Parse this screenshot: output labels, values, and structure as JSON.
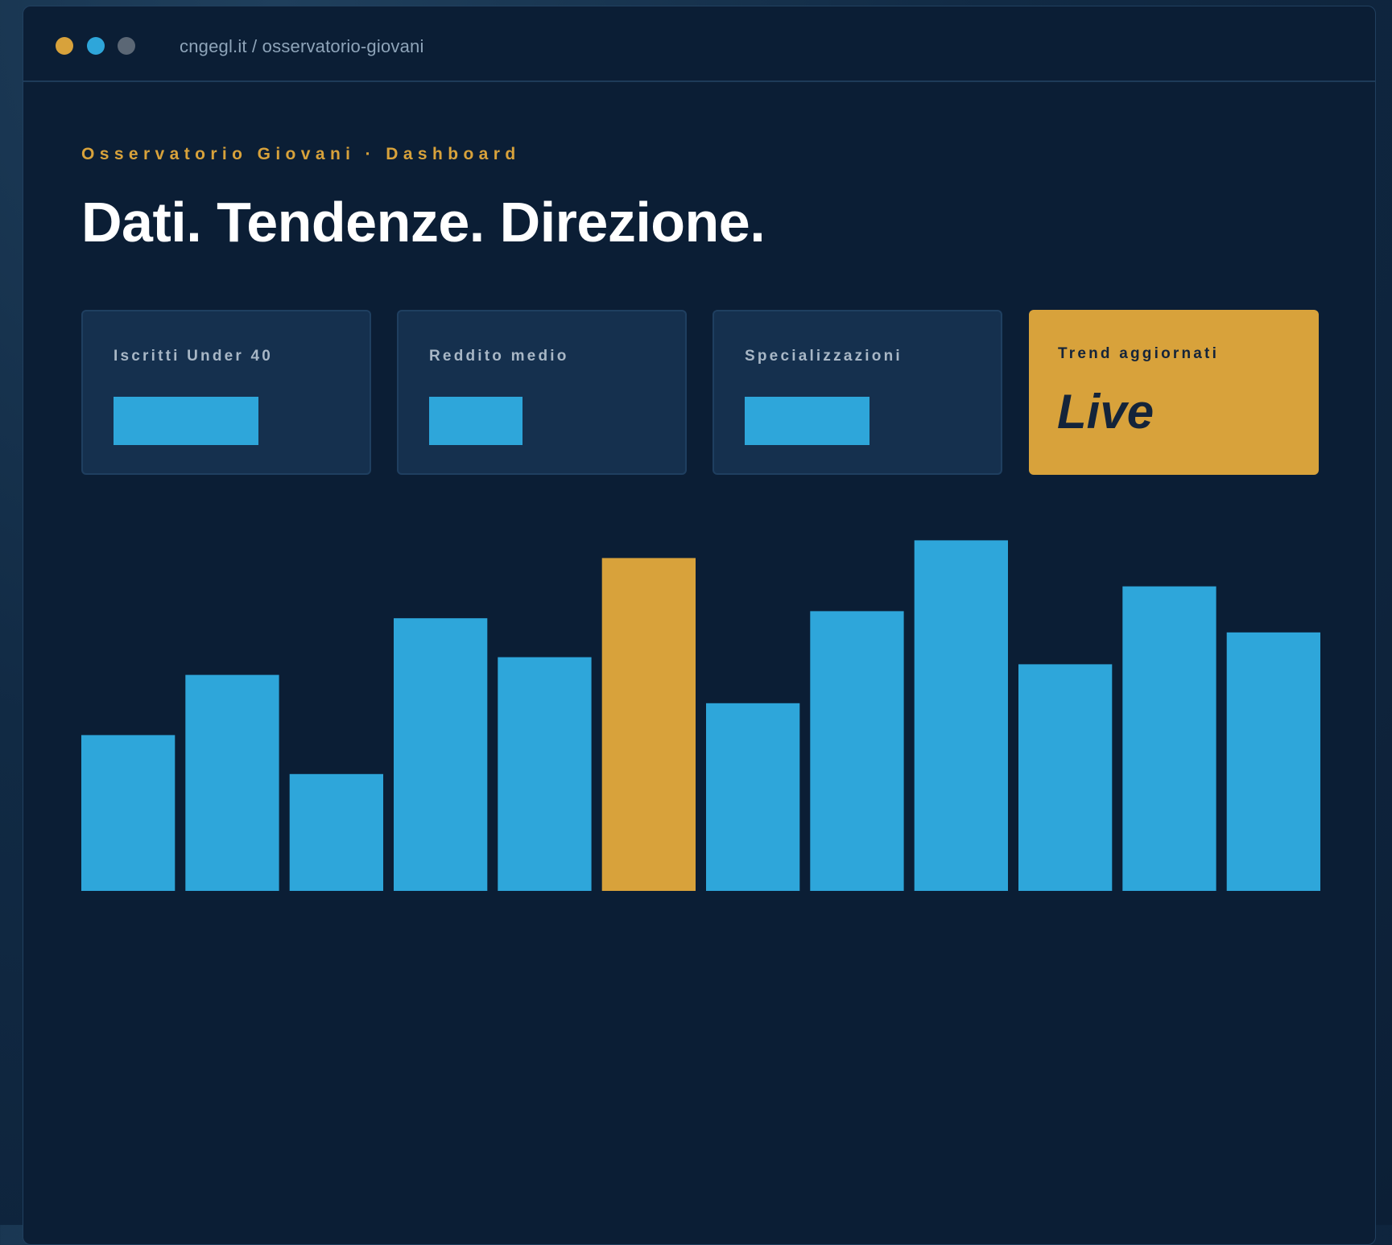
{
  "window": {
    "url": "cngegl.it / osservatorio-giovani",
    "traffic_lights": [
      {
        "name": "dot-amber",
        "color": "#d8a23b"
      },
      {
        "name": "dot-blue",
        "color": "#2ea6da"
      },
      {
        "name": "dot-grey",
        "color": "#5b6775"
      }
    ]
  },
  "header": {
    "eyebrow": "Osservatorio Giovani · Dashboard",
    "title": "Dati. Tendenze. Direzione."
  },
  "colors": {
    "accent": "#d8a23b",
    "primary": "#2ea6da",
    "background": "#0b1e35",
    "card": "#15304e",
    "ink": "#14243a"
  },
  "cards": [
    {
      "label": "Iscritti Under 40",
      "level": 0.64
    },
    {
      "label": "Reddito medio",
      "level": 0.41
    },
    {
      "label": "Specializzazioni",
      "level": 0.55
    }
  ],
  "live_card": {
    "label": "Trend aggiornati",
    "value": "Live"
  },
  "chart_data": {
    "type": "bar",
    "ylim": [
      0,
      100
    ],
    "values": [
      44,
      61,
      33,
      77,
      66,
      94,
      53,
      79,
      99,
      64,
      86,
      73
    ],
    "highlight_index": 5,
    "grid": false
  }
}
